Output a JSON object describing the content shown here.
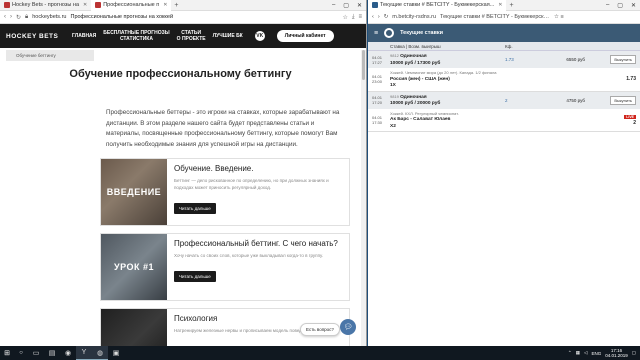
{
  "left_browser": {
    "tabs": [
      {
        "label": "Hockey Bets - прогнозы на",
        "active": false
      },
      {
        "label": "Профессиональные п",
        "active": true
      }
    ],
    "url": "hockeybets.ru",
    "page_title": "Профессиональные прогнозы на хоккей"
  },
  "site": {
    "logo": "HOCKEY BETS",
    "nav": [
      "ГЛАВНАЯ",
      "БЕСПЛАТНЫЕ ПРОГНОЗЫ\nСТАТИСТИКА",
      "СТАТЬИ\nО ПРОЕКТЕ",
      "ЛУЧШИЕ БК"
    ],
    "vk_label": "VK",
    "cabinet_button": "Личный кабинет",
    "breadcrumb": "Обучение беттингу",
    "title": "Обучение профессиональному беттингу",
    "intro": "Профессиональные беттеры - это игроки на ставках, которые зарабатывают на дистанции. В этом разделе нашего сайта будет представлены статьи и материалы, посвященные профессиональному беттингу, которые помогут Вам получить необходимые знания для успешной игры на дистанции.",
    "cards": [
      {
        "image_label": "ВВЕДЕНИЕ",
        "title": "Обучение. Введение.",
        "text": "Беттинг — дело рискованное по определению, но при должных знаниях и подходах может приносить регулярный доход.",
        "button": "Читать дальше"
      },
      {
        "image_label": "УРОК #1",
        "title": "Профессиональный беттинг. С чего начать?",
        "text": "Хочу начать со своих слов, которые уже выкладывал когда-то в группу.",
        "button": "Читать дальше"
      },
      {
        "image_label": "",
        "title": "Психология",
        "text": "Натренируем железные нервы и прописываем модель поведения на",
        "button": ""
      }
    ],
    "chat_label": "Есть вопрос?"
  },
  "right_browser": {
    "tab_label": "Текущие ставки # BETCITY - Букмекерская...",
    "url": "m.betcity-rsdns.ru",
    "page_title": "Текущие ставки # BETCITY - Букмекерска...",
    "header_title": "Текущие ставки",
    "columns": [
      "Ставка | Возм. выигрыш",
      "Кф."
    ],
    "bets": [
      {
        "date": "04.01",
        "time": "17:27",
        "id": "9812",
        "type": "Одиночная",
        "amount": "10000 руб / 17300 руб",
        "coef": "1.73",
        "sum": "6550 руб",
        "button": "Выкупить",
        "event_date": "04.01",
        "event_time": "23:00",
        "event_league": "Хоккей. Чемпионат мира (до 20 лет). Канада. 1/2 финала",
        "event_match": "Россия (жен) - США (жен)",
        "event_pick": "1Х",
        "event_coef": "1.73",
        "live": false
      },
      {
        "date": "04.01",
        "time": "17:20",
        "id": "9819",
        "type": "Одиночная",
        "amount": "10000 руб / 20000 руб",
        "coef": "2",
        "sum": "4750 руб",
        "button": "Выкупить",
        "event_date": "04.01",
        "event_time": "17:30",
        "event_league": "Хоккей. КХЛ. Регулярный чемпионат.",
        "event_match": "Ак Барс - Салават Юлаев",
        "event_pick": "Х2",
        "event_coef": "2",
        "live": true
      }
    ],
    "live_label": "LIVE"
  },
  "taskbar": {
    "lang": "ENG",
    "time": "17:16",
    "date": "04.01.2019"
  }
}
